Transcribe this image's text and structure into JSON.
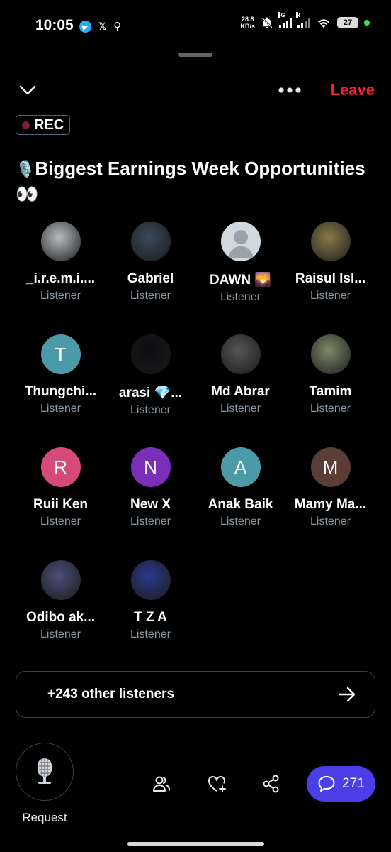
{
  "status_bar": {
    "time": "10:05",
    "net_speed_value": "28.8",
    "net_speed_unit": "KB/s",
    "network_type": "5G",
    "roaming": "R",
    "battery": "27"
  },
  "header": {
    "leave_label": "Leave",
    "rec_label": "REC",
    "title_emoji": "🎙️",
    "title": "Biggest Earnings Week Opportunities",
    "title_trailing_emoji": "👀"
  },
  "participants": [
    {
      "name": "_i.r.e.m.i....",
      "role": "Listener",
      "avatar_initial": "",
      "avatar_color": "#b9bcbf"
    },
    {
      "name": "Gabriel",
      "role": "Listener",
      "avatar_initial": "",
      "avatar_color": "#3a4a5a"
    },
    {
      "name": "DAWN 🌄",
      "role": "Listener",
      "avatar_initial": "",
      "avatar_color": "#cfd9de"
    },
    {
      "name": "Raisul Isl...",
      "role": "Listener",
      "avatar_initial": "",
      "avatar_color": "#8a7a4a"
    },
    {
      "name": "Thungchi...",
      "role": "Listener",
      "avatar_initial": "T",
      "avatar_color": "#4a9aa7"
    },
    {
      "name": "arasi 💎...",
      "role": "Listener",
      "avatar_initial": "",
      "avatar_color": "#0d0d12"
    },
    {
      "name": "Md Abrar",
      "role": "Listener",
      "avatar_initial": "",
      "avatar_color": "#555555"
    },
    {
      "name": "Tamim",
      "role": "Listener",
      "avatar_initial": "",
      "avatar_color": "#7d8a6a"
    },
    {
      "name": "Ruii Ken",
      "role": "Listener",
      "avatar_initial": "R",
      "avatar_color": "#d64a7a"
    },
    {
      "name": "New X",
      "role": "Listener",
      "avatar_initial": "N",
      "avatar_color": "#7b2fb8"
    },
    {
      "name": "Anak Baik",
      "role": "Listener",
      "avatar_initial": "A",
      "avatar_color": "#4a9aa7"
    },
    {
      "name": "Mamy Ma...",
      "role": "Listener",
      "avatar_initial": "M",
      "avatar_color": "#5a3d34"
    },
    {
      "name": "Odibo ak...",
      "role": "Listener",
      "avatar_initial": "",
      "avatar_color": "#4a4f78"
    },
    {
      "name": "T Z A",
      "role": "Listener",
      "avatar_initial": "",
      "avatar_color": "#2a3a8a"
    }
  ],
  "other_listeners": {
    "label": "+243 other listeners"
  },
  "bottom_bar": {
    "request_label": "Request",
    "chat_count": "271"
  },
  "colors": {
    "leave": "#f4212e",
    "chat_button": "#4a3ee6",
    "secondary_text": "#8b98a5"
  }
}
